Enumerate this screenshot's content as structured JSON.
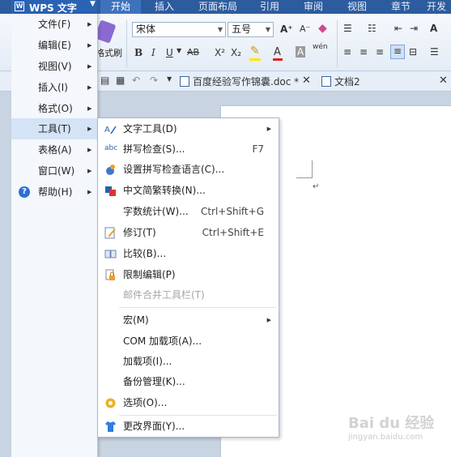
{
  "app": {
    "title": "WPS 文字"
  },
  "tabs": [
    "开始",
    "插入",
    "页面布局",
    "引用",
    "审阅",
    "视图",
    "章节",
    "开发"
  ],
  "ribbon": {
    "format_painter": "格式刷",
    "font": "宋体",
    "font_size": "五号",
    "text_icons": {
      "bold": "B",
      "italic": "I",
      "underline": "U",
      "strike": "AB",
      "superscript": "X²",
      "subscript": "X₂",
      "font_color": "A",
      "shade": "A",
      "grow": "A⁺",
      "shrink": "A⁻",
      "pinyin": "wén"
    }
  },
  "doc_tabs": [
    {
      "label": "百度经验写作锦囊.doc *"
    },
    {
      "label": "文档2"
    }
  ],
  "left_menu": {
    "items": [
      {
        "label": "文件(F)",
        "arrow": "▶"
      },
      {
        "label": "编辑(E)",
        "arrow": "▶"
      },
      {
        "label": "视图(V)",
        "arrow": "▶"
      },
      {
        "label": "插入(I)",
        "arrow": "▶"
      },
      {
        "label": "格式(O)",
        "arrow": "▶"
      },
      {
        "label": "工具(T)",
        "arrow": "▶"
      },
      {
        "label": "表格(A)",
        "arrow": "▶"
      },
      {
        "label": "窗口(W)",
        "arrow": "▶"
      },
      {
        "label": "帮助(H)",
        "arrow": "▶"
      }
    ]
  },
  "tools_menu": {
    "items": [
      {
        "label": "文字工具(D)",
        "shortcut": "",
        "arrow": "▶",
        "icon": "text-tools-icon"
      },
      {
        "label": "拼写检查(S)...",
        "shortcut": "F7",
        "arrow": "",
        "icon": "spellcheck-icon",
        "icon_text": "abc"
      },
      {
        "label": "设置拼写检查语言(C)...",
        "shortcut": "",
        "arrow": "",
        "icon": "language-icon"
      },
      {
        "label": "中文简繁转换(N)...",
        "shortcut": "",
        "arrow": "",
        "icon": "convert-icon"
      },
      {
        "label": "字数统计(W)...",
        "shortcut": "Ctrl+Shift+G",
        "arrow": "",
        "icon": ""
      },
      {
        "label": "修订(T)",
        "shortcut": "Ctrl+Shift+E",
        "arrow": "",
        "icon": "track-changes-icon"
      },
      {
        "label": "比较(B)...",
        "shortcut": "",
        "arrow": "",
        "icon": "compare-icon"
      },
      {
        "label": "限制编辑(P)",
        "shortcut": "",
        "arrow": "",
        "icon": "lock-icon"
      },
      {
        "label": "邮件合并工具栏(T)",
        "shortcut": "",
        "arrow": "",
        "icon": ""
      },
      {
        "label": "宏(M)",
        "shortcut": "",
        "arrow": "▶",
        "icon": ""
      },
      {
        "label": "COM 加载项(A)...",
        "shortcut": "",
        "arrow": "",
        "icon": ""
      },
      {
        "label": "加载项(I)...",
        "shortcut": "",
        "arrow": "",
        "icon": ""
      },
      {
        "label": "备份管理(K)...",
        "shortcut": "",
        "arrow": "",
        "icon": ""
      },
      {
        "label": "选项(O)...",
        "shortcut": "",
        "arrow": "",
        "icon": "gear-icon"
      },
      {
        "label": "更改界面(Y)...",
        "shortcut": "",
        "arrow": "",
        "icon": "shirt-icon"
      }
    ]
  },
  "watermark": {
    "line1": "Bai du 经验",
    "line2": "jingyan.baidu.com"
  },
  "colors": {
    "tabbar": "#2c5c9e",
    "active_tab": "#3f72bd",
    "highlight": "#d4e3f6",
    "disabled": "#a6a6a6"
  }
}
